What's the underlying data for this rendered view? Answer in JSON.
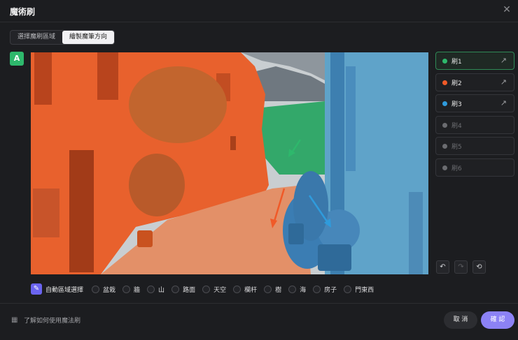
{
  "dialog": {
    "title": "魔術刷",
    "close_icon": "close-icon"
  },
  "tabs": [
    {
      "label": "選擇魔刷區域",
      "active": false
    },
    {
      "label": "繪製魔筆方向",
      "active": true
    }
  ],
  "badge": {
    "label": "A"
  },
  "brushes": [
    {
      "label": "刷1",
      "color": "#2eb86c",
      "enabled": true,
      "selected": true
    },
    {
      "label": "刷2",
      "color": "#f05a28",
      "enabled": true,
      "selected": false
    },
    {
      "label": "刷3",
      "color": "#2f9bdc",
      "enabled": true,
      "selected": false
    },
    {
      "label": "刷4",
      "color": "#6b6c70",
      "enabled": false,
      "selected": false
    },
    {
      "label": "刷5",
      "color": "#6b6c70",
      "enabled": false,
      "selected": false
    },
    {
      "label": "刷6",
      "color": "#6b6c70",
      "enabled": false,
      "selected": false
    }
  ],
  "tools": {
    "undo": "undo-icon",
    "redo": "redo-icon",
    "reset": "reset-icon"
  },
  "auto_select": {
    "label": "自動區域選擇",
    "icon": "magic-wand-icon"
  },
  "categories": [
    "盆栽",
    "牆",
    "山",
    "路面",
    "天空",
    "欄杆",
    "樹",
    "海",
    "房子",
    "門東西"
  ],
  "footer": {
    "help_label": "了解如何使用魔法刷",
    "cancel_label": "取 消",
    "confirm_label": "確 認"
  },
  "colors": {
    "accent": "#8c82f5",
    "green": "#2eb86c",
    "orange": "#f05a28",
    "blue": "#2f9bdc"
  }
}
